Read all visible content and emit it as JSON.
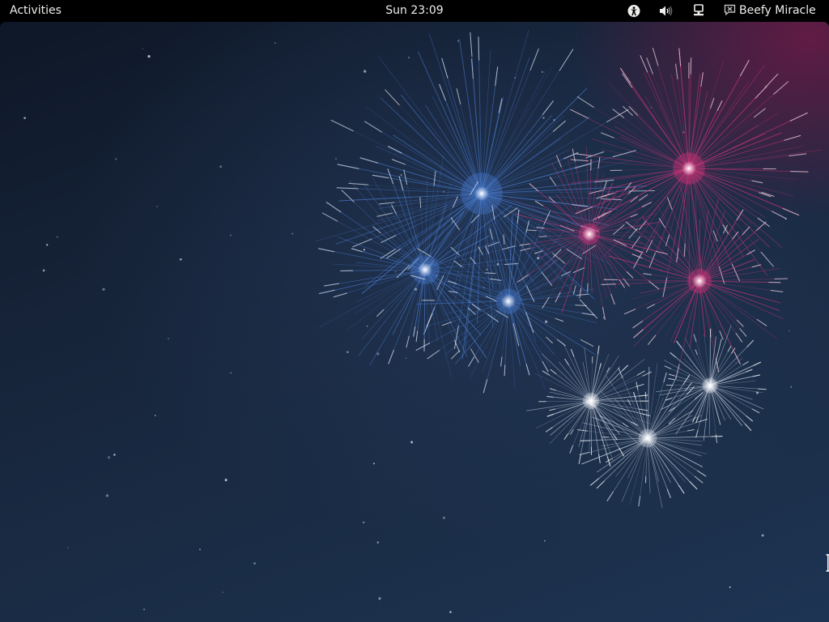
{
  "topbar": {
    "activities_label": "Activities",
    "clock": "Sun 23:09",
    "accessibility_icon": "accessibility-icon",
    "volume_icon": "volume-icon",
    "network_icon": "network-wired-icon",
    "user_status_icon": "user-status-icon",
    "user_name": "Beefy Miracle"
  },
  "desktop": {
    "wallpaper": "fireworks",
    "colors": {
      "sky_top": "#0e1727",
      "sky_bottom": "#1d3453",
      "firework_blue": "#4a7fd6",
      "firework_pink": "#e0357f",
      "firework_white": "#dfe6f2"
    }
  }
}
